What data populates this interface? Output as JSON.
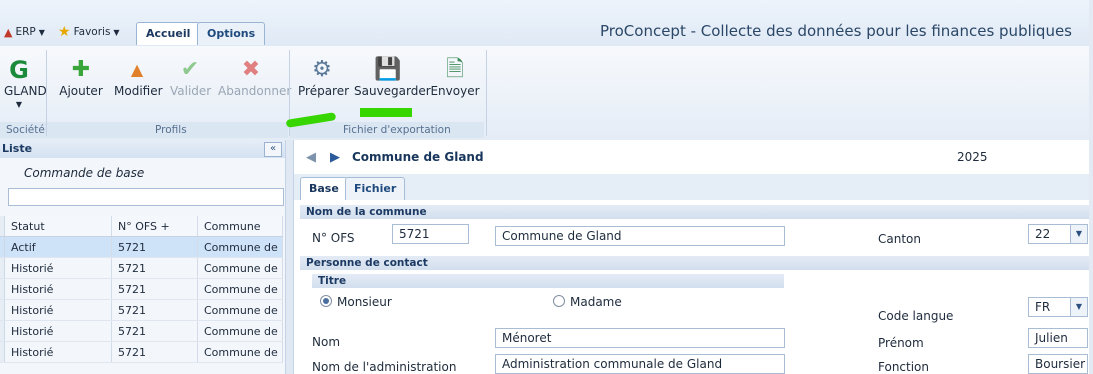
{
  "window": {
    "title": "ProConcept - Collecte des données pour les finances publiques"
  },
  "qat": {
    "erp_label": "ERP",
    "favoris_label": "Favoris"
  },
  "tabs": [
    {
      "label": "Accueil"
    },
    {
      "label": "Options"
    }
  ],
  "ribbon": {
    "societe": {
      "button": "GLAND",
      "group": "Société"
    },
    "profils": {
      "group": "Profils",
      "buttons": [
        {
          "label": "Ajouter",
          "icon": "plus-icon"
        },
        {
          "label": "Modifier",
          "icon": "triangle-up-icon"
        },
        {
          "label": "Valider",
          "icon": "checkmark-icon"
        },
        {
          "label": "Abandonner",
          "icon": "x-icon"
        }
      ]
    },
    "export": {
      "group": "Fichier d'exportation",
      "buttons": [
        {
          "label": "Préparer",
          "icon": "gear-icon"
        },
        {
          "label": "Sauvegarder",
          "icon": "floppy-disk-icon"
        },
        {
          "label": "Envoyer",
          "icon": "send-file-icon"
        }
      ]
    }
  },
  "left_panel": {
    "title": "Liste",
    "subtitle": "Commande de base",
    "collapse_glyph": "«",
    "columns": [
      "Statut",
      "N° OFS +",
      "Commune"
    ],
    "rows": [
      [
        "Actif",
        "5721",
        "Commune de"
      ],
      [
        "Historié",
        "5721",
        "Commune de"
      ],
      [
        "Historié",
        "5721",
        "Commune de"
      ],
      [
        "Historié",
        "5721",
        "Commune de"
      ],
      [
        "Historié",
        "5721",
        "Commune de"
      ],
      [
        "Historié",
        "5721",
        "Commune de"
      ]
    ]
  },
  "record": {
    "title": "Commune de Gland",
    "year": "2025"
  },
  "subtabs": [
    {
      "label": "Base"
    },
    {
      "label": "Fichier"
    }
  ],
  "form": {
    "section_commune": "Nom de la commune",
    "ofs_label": "N° OFS",
    "ofs_value": "5721",
    "commune_value": "Commune de Gland",
    "canton_label": "Canton",
    "canton_value": "22",
    "section_contact": "Personne de contact",
    "titre_label": "Titre",
    "radio_monsieur": "Monsieur",
    "radio_madame": "Madame",
    "code_langue_label": "Code langue",
    "code_langue_value": "FR",
    "nom_label": "Nom",
    "nom_value": "Ménoret",
    "prenom_label": "Prénom",
    "prenom_value": "Julien",
    "admin_label": "Nom de l'administration",
    "admin_value": "Administration communale de Gland",
    "fonction_label": "Fonction",
    "fonction_value": "Boursier"
  },
  "colors": {
    "accent": "#1f4a7e",
    "highlight_stroke": "#38d600",
    "selection": "#cfe3f8"
  }
}
